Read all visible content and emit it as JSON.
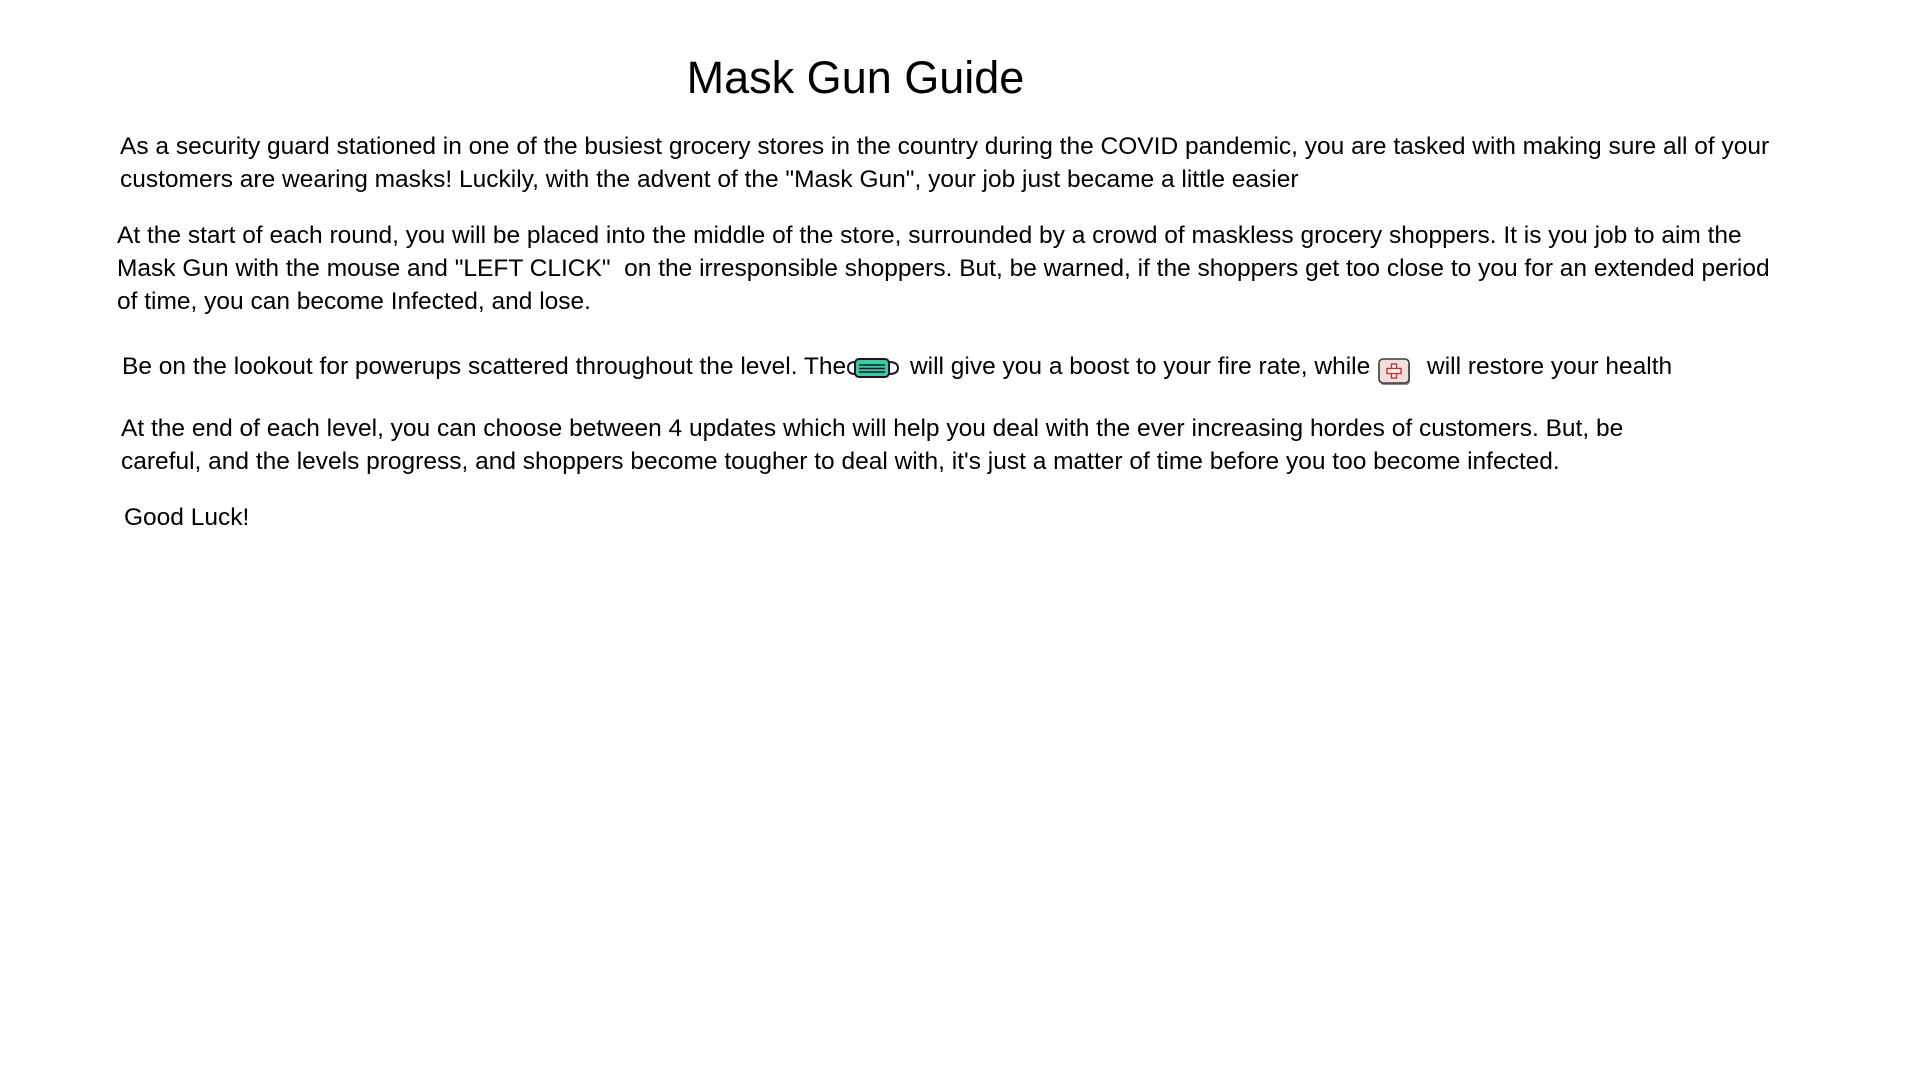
{
  "title": "Mask Gun Guide",
  "paragraphs": {
    "intro": {
      "line1": "As a security guard stationed in one of the busiest grocery stores in the country during the COVID pandemic, you are tasked with making sure all of your",
      "line2": "customers are wearing masks! Luckily, with the advent of the \"Mask Gun\", your job just became a little easier"
    },
    "round": {
      "line1": "At the start of each round, you will be placed into the middle of the store, surrounded by a crowd of maskless grocery shoppers. It is you job to aim the",
      "line2": "Mask Gun with the mouse and \"LEFT CLICK\"  on the irresponsible shoppers. But, be warned, if the shoppers get too close to you for an extended period",
      "line3": "of time, you can become Infected, and lose."
    },
    "powerups": {
      "before_mask": "Be on the lookout for powerups scattered throughout the level. The",
      "after_mask": " will give you a boost to your fire rate, while",
      "after_medkit": " will restore your health"
    },
    "levels": {
      "line1": "At the end of each level, you can choose between 4 updates which will help you deal with the ever increasing hordes of customers. But, be",
      "line2": "careful, and the levels progress, and shoppers become tougher to deal with, it's just a matter of time before you too become infected."
    },
    "closing": "Good Luck!"
  },
  "icons": {
    "fire_rate_powerup": "face-mask-icon",
    "health_powerup": "medkit-icon"
  },
  "colors": {
    "mask_fill": "#3cc9a8",
    "mask_outline": "#1a1a1a",
    "medkit_fill": "#f2dede",
    "medkit_cross": "#d22b2b"
  }
}
